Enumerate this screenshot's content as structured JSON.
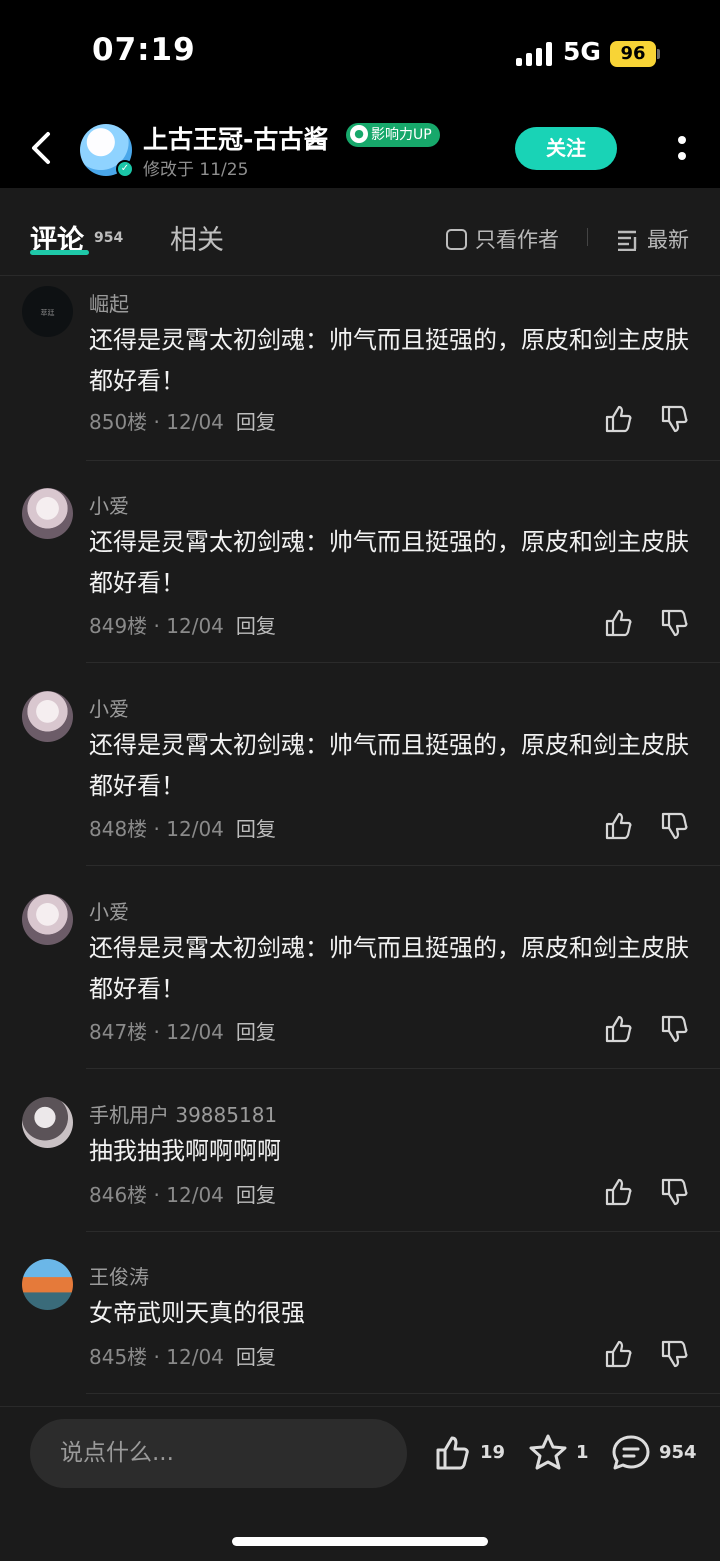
{
  "status": {
    "time": "07:19",
    "network": "5G",
    "battery": "96"
  },
  "header": {
    "author": "上古王冠-古古酱",
    "badge": "影响力UP",
    "modified": "修改于 11/25",
    "follow_label": "关注"
  },
  "tabs": {
    "comments_label": "评论",
    "comments_count": "954",
    "related_label": "相关",
    "author_only_label": "只看作者",
    "sort_label": "最新"
  },
  "comments": [
    {
      "name": "崛起",
      "avatar_text": "萃廷",
      "text": "还得是灵霄太初剑魂：帅气而且挺强的，原皮和剑主皮肤都好看！",
      "floor": "850楼",
      "date": "12/04",
      "reply": "回复"
    },
    {
      "name": "小爱",
      "text": "还得是灵霄太初剑魂：帅气而且挺强的，原皮和剑主皮肤都好看！",
      "floor": "849楼",
      "date": "12/04",
      "reply": "回复"
    },
    {
      "name": "小爱",
      "text": "还得是灵霄太初剑魂：帅气而且挺强的，原皮和剑主皮肤都好看！",
      "floor": "848楼",
      "date": "12/04",
      "reply": "回复"
    },
    {
      "name": "小爱",
      "text": "还得是灵霄太初剑魂：帅气而且挺强的，原皮和剑主皮肤都好看！",
      "floor": "847楼",
      "date": "12/04",
      "reply": "回复"
    },
    {
      "name": "手机用户 39885181",
      "text": "抽我抽我啊啊啊啊",
      "floor": "846楼",
      "date": "12/04",
      "reply": "回复"
    },
    {
      "name": "王俊涛",
      "text": "女帝武则天真的很强",
      "floor": "845楼",
      "date": "12/04",
      "reply": "回复"
    }
  ],
  "bottom": {
    "input_placeholder": "说点什么...",
    "likes": "19",
    "favorites": "1",
    "comments": "954"
  },
  "colors": {
    "accent": "#19d3b6",
    "background": "#1b1b1b",
    "badge": "#17a86b"
  },
  "icons": [
    "back-arrow-icon",
    "more-icon",
    "checkbox-icon",
    "sort-list-icon",
    "thumb-up-icon",
    "thumb-down-icon",
    "star-icon",
    "chat-bubble-icon"
  ]
}
